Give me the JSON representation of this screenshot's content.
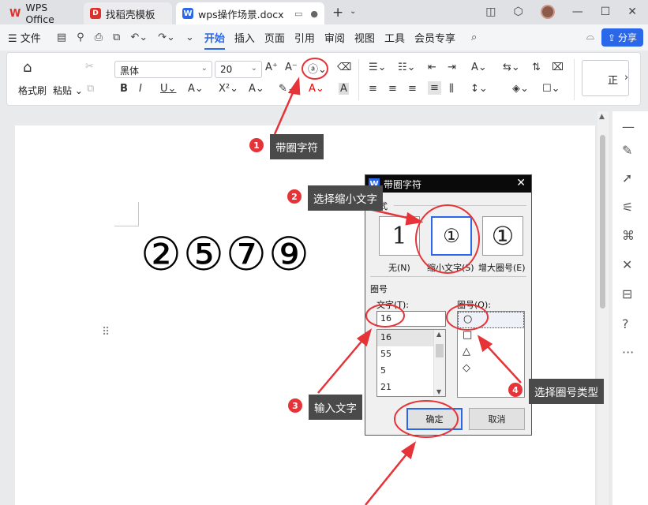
{
  "tabs": [
    {
      "label": "WPS Office"
    },
    {
      "label": "找稻壳模板"
    },
    {
      "label": "wps操作场景.docx"
    }
  ],
  "menu": {
    "file": "文件",
    "items": [
      "开始",
      "插入",
      "页面",
      "引用",
      "审阅",
      "视图",
      "工具",
      "会员专享"
    ],
    "active": "开始",
    "share": "分享"
  },
  "ribbon": {
    "format_painter": "格式刷",
    "paste": "粘贴",
    "font_name": "黑体",
    "font_size": "20",
    "style_preview": "正"
  },
  "document": {
    "circled_text": "②⑤⑦⑨"
  },
  "dialog": {
    "title": "带圈字符",
    "style_section": "样式",
    "styles": [
      {
        "sample": "1",
        "label": "无(N)"
      },
      {
        "sample": "①",
        "label": "缩小文字(S)"
      },
      {
        "sample": "①",
        "label": "增大圈号(E)"
      }
    ],
    "circle_section": "圈号",
    "text_label": "文字(T):",
    "text_value": "16",
    "text_options": [
      "16",
      "55",
      "5",
      "21"
    ],
    "shape_label": "圈号(O):",
    "shapes": [
      "○",
      "□",
      "△",
      "◇"
    ],
    "ok": "确定",
    "cancel": "取消"
  },
  "annotations": [
    {
      "num": "1",
      "text": "带圈字符"
    },
    {
      "num": "2",
      "text": "选择缩小文字"
    },
    {
      "num": "3",
      "text": "输入文字"
    },
    {
      "num": "4",
      "text": "选择圈号类型"
    }
  ],
  "colors": {
    "accent": "#2b68e9",
    "annotation_red": "#e63338",
    "callout_bg": "#4a4a4a"
  }
}
